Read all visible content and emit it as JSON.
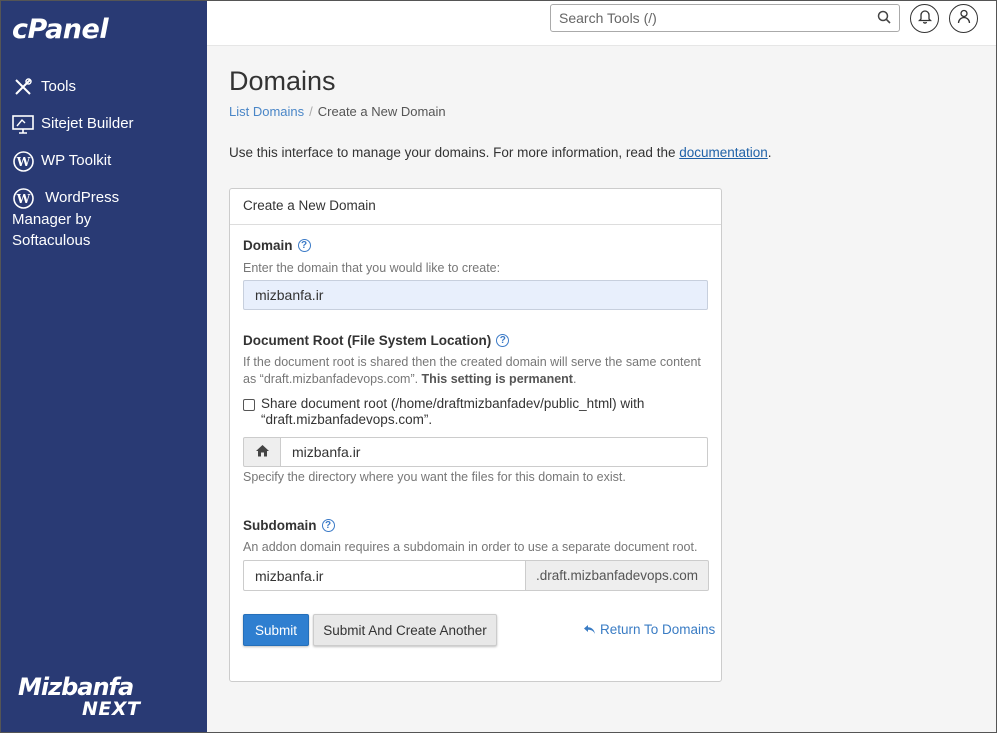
{
  "sidebar": {
    "logo": "cPanel",
    "items": [
      {
        "label": "Tools",
        "icon": "tools-icon"
      },
      {
        "label": "Sitejet Builder",
        "icon": "sitejet-icon"
      },
      {
        "label": "WP Toolkit",
        "icon": "wordpress-icon"
      },
      {
        "label": "WordPress Manager by Softaculous",
        "icon": "wordpress-icon"
      }
    ],
    "brand_line1": "Mizbanfa",
    "brand_line2": "NEXT"
  },
  "topbar": {
    "search_placeholder": "Search Tools (/)"
  },
  "page": {
    "title": "Domains",
    "breadcrumb": {
      "link": "List Domains",
      "separator": "/",
      "current": "Create a New Domain"
    },
    "intro_text": "Use this interface to manage your domains. For more information, read the ",
    "intro_link": "documentation",
    "intro_end": "."
  },
  "form": {
    "panel_title": "Create a New Domain",
    "help_glyph": "?",
    "domain": {
      "label": "Domain",
      "hint": "Enter the domain that you would like to create:",
      "value": "mizbanfa.ir"
    },
    "docroot": {
      "label": "Document Root (File System Location)",
      "hint_1": "If the document root is shared then the created domain will serve the same content as “draft.mizbanfadevops.com”. ",
      "hint_bold": "This setting is permanent",
      "hint_end": ".",
      "share_checkbox_label": "Share document root (/home/draftmizbanfadev/public_html) with “draft.mizbanfadevops.com”.",
      "share_checked": false,
      "value": "mizbanfa.ir",
      "after_hint": "Specify the directory where you want the files for this domain to exist."
    },
    "subdomain": {
      "label": "Subdomain",
      "hint": "An addon domain requires a subdomain in order to use a separate document root.",
      "value": "mizbanfa.ir",
      "suffix": ".draft.mizbanfadevops.com"
    },
    "submit_label": "Submit",
    "submit_another_label": "Submit And Create Another",
    "return_label": "Return To Domains"
  },
  "colors": {
    "sidebar_bg": "#293a74",
    "primary_button": "#2f7fd0",
    "link": "#3a7cc4"
  }
}
